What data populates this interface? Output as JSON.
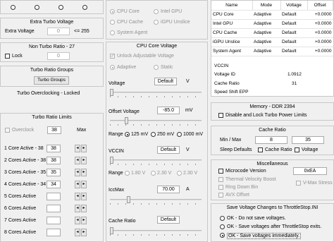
{
  "left": {
    "top_radios": 4,
    "extra_turbo": {
      "title": "Extra Turbo Voltage",
      "label": "Extra Voltage",
      "value": "0",
      "range": "<= 255"
    },
    "non_turbo": {
      "title": "Non Turbo Ratio - 27",
      "lock_label": "Lock",
      "value": "0"
    },
    "turbo_groups": {
      "title": "Turbo Ratio Groups",
      "button": "Turbo Groups"
    },
    "overclock_title": "Turbo Overclocking - Locked",
    "limits": {
      "title": "Turbo Ratio Limits",
      "overclock_label": "Overclock",
      "overclock_value": "38",
      "max_label": "Max",
      "rows": [
        {
          "label": "1 Core  Active - 38",
          "value": "38"
        },
        {
          "label": "2 Cores Active - 38",
          "value": "38"
        },
        {
          "label": "3 Cores Active - 35",
          "value": "35"
        },
        {
          "label": "4 Cores Active - 34",
          "value": "34"
        },
        {
          "label": "5 Cores Active",
          "value": ""
        },
        {
          "label": "6 Cores Active",
          "value": ""
        },
        {
          "label": "7 Cores Active",
          "value": ""
        },
        {
          "label": "8 Cores Active",
          "value": ""
        }
      ]
    }
  },
  "middle": {
    "domains": {
      "cpu_core": "CPU Core",
      "intel_gpu": "Intel GPU",
      "cpu_cache": "CPU Cache",
      "igpu_unslice": "iGPU Unslice",
      "system_agent": "System Agent"
    },
    "cpu_voltage": {
      "title": "CPU Core Voltage",
      "unlock_label": "Unlock Adjustable Voltage",
      "adaptive": "Adaptive",
      "static": "Static",
      "voltage_label": "Voltage",
      "voltage_value": "Default",
      "voltage_unit": "V",
      "offset_label": "Offset Voltage",
      "offset_value": "-85.0",
      "offset_unit": "mV",
      "range_label": "Range",
      "range_options": [
        "125 mV",
        "250 mV",
        "1000 mV"
      ],
      "vccin_label": "VCCIN",
      "vccin_value": "Default",
      "vccin_unit": "V",
      "vccin_range": [
        "1.80 V",
        "2.30 V",
        "2.30 V"
      ],
      "iccmax_label": "IccMax",
      "iccmax_value": "70.00",
      "iccmax_unit": "A",
      "cache_ratio_label": "Cache Ratio",
      "cache_ratio_value": "Default"
    }
  },
  "right": {
    "table": {
      "headers": [
        "Name",
        "Mode",
        "Voltage",
        "Offset"
      ],
      "rows": [
        [
          "CPU Core",
          "Adaptive",
          "Default",
          "+0.0000"
        ],
        [
          "Intel GPU",
          "Adaptive",
          "Default",
          "+0.0000"
        ],
        [
          "CPU Cache",
          "Adaptive",
          "Default",
          "+0.0000"
        ],
        [
          "iGPU Unslice",
          "Adaptive",
          "Default",
          "+0.0000"
        ],
        [
          "System Agent",
          "Adaptive",
          "Default",
          "+0.0000"
        ]
      ]
    },
    "info": {
      "vccin": "VCCIN",
      "voltage_id_label": "Voltage ID",
      "voltage_id_value": "1.0912",
      "cache_ratio_label": "Cache Ratio",
      "cache_ratio_value": "31",
      "speed_shift": "Speed Shift EPP"
    },
    "memory": {
      "title": "Memory - DDR 2394",
      "disable_label": "Disable and Lock Turbo Power Limits"
    },
    "cache_ratio": {
      "title": "Cache Ratio",
      "minmax_label": "Min / Max",
      "min": "8",
      "max": "35",
      "sleep_label": "Sleep Defaults",
      "cache_ratio_cb": "Cache Ratio",
      "voltage_cb": "Voltage"
    },
    "misc": {
      "title": "Miscellaneous",
      "microcode_label": "Microcode Version",
      "microcode_value": "0xEA",
      "thermal_label": "Thermal Velocity Boost",
      "ring_label": "Ring Down Bin",
      "avx_label": "AVX Offset",
      "vmax_label": "V-Max Stress"
    },
    "save": {
      "title": "Save Voltage Changes to ThrottleStop.INI",
      "options": [
        "OK - Do not save voltages.",
        "OK - Save voltages after ThrottleStop exits.",
        "OK - Save voltages immediately."
      ]
    }
  }
}
